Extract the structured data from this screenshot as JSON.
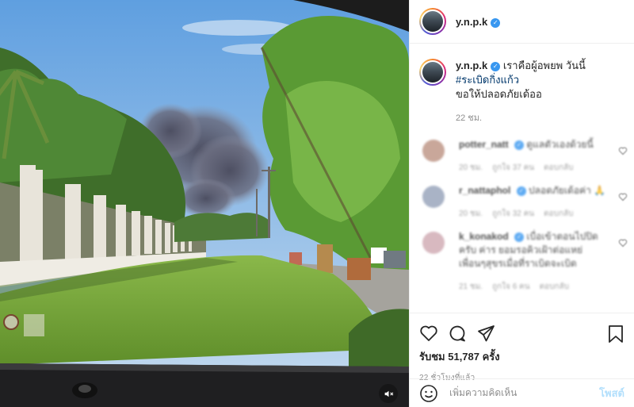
{
  "header": {
    "username": "y.n.p.k",
    "verified_icon": "verified-badge-icon"
  },
  "caption": {
    "username": "y.n.p.k",
    "line1": "เราคือผู้อพยพ วันนี้",
    "hashtag": "#ระเบิดกิ่งแก้ว",
    "line3": "ขอให้ปลอดภัยเด้ออ",
    "time": "22 ชม."
  },
  "comments": [
    {
      "username": "potter_natt",
      "text": "ดูแลตัวเองด้วยนี้",
      "time": "20 ชม.",
      "likes": "ถูกใจ 37 คน",
      "reply": "ตอบกลับ",
      "avatar_color": "#c9a79a"
    },
    {
      "username": "r_nattaphol",
      "text": "ปลอดภัยเด้อค่า 🙏",
      "time": "20 ชม.",
      "likes": "ถูกใจ 32 คน",
      "reply": "ตอบกลับ",
      "avatar_color": "#a9b3c6"
    },
    {
      "username": "k_konakod",
      "text": "เบื่อเข้าตอนไปปิด ครับ ค่าร ยอมรอคิวเฝ้าต่อแหย่ เพื่อนๆสุขรเมื่อที่ราเบิดจะเบิด",
      "time": "21 ชม.",
      "likes": "ถูกใจ 6 คน",
      "reply": "ตอบกลับ",
      "avatar_color": "#d8b9c0"
    }
  ],
  "actions": {
    "likes_text": "รับชม 51,787 ครั้ง",
    "posted": "22 ชั่วโมงที่แล้ว"
  },
  "add_comment": {
    "placeholder": "เพิ่มความคิดเห็น",
    "post_label": "โพสต์"
  },
  "colors": {
    "accent": "#3897f0",
    "link": "#00376b",
    "post_disabled": "#b2dffc",
    "muted": "#8e8e8e"
  }
}
